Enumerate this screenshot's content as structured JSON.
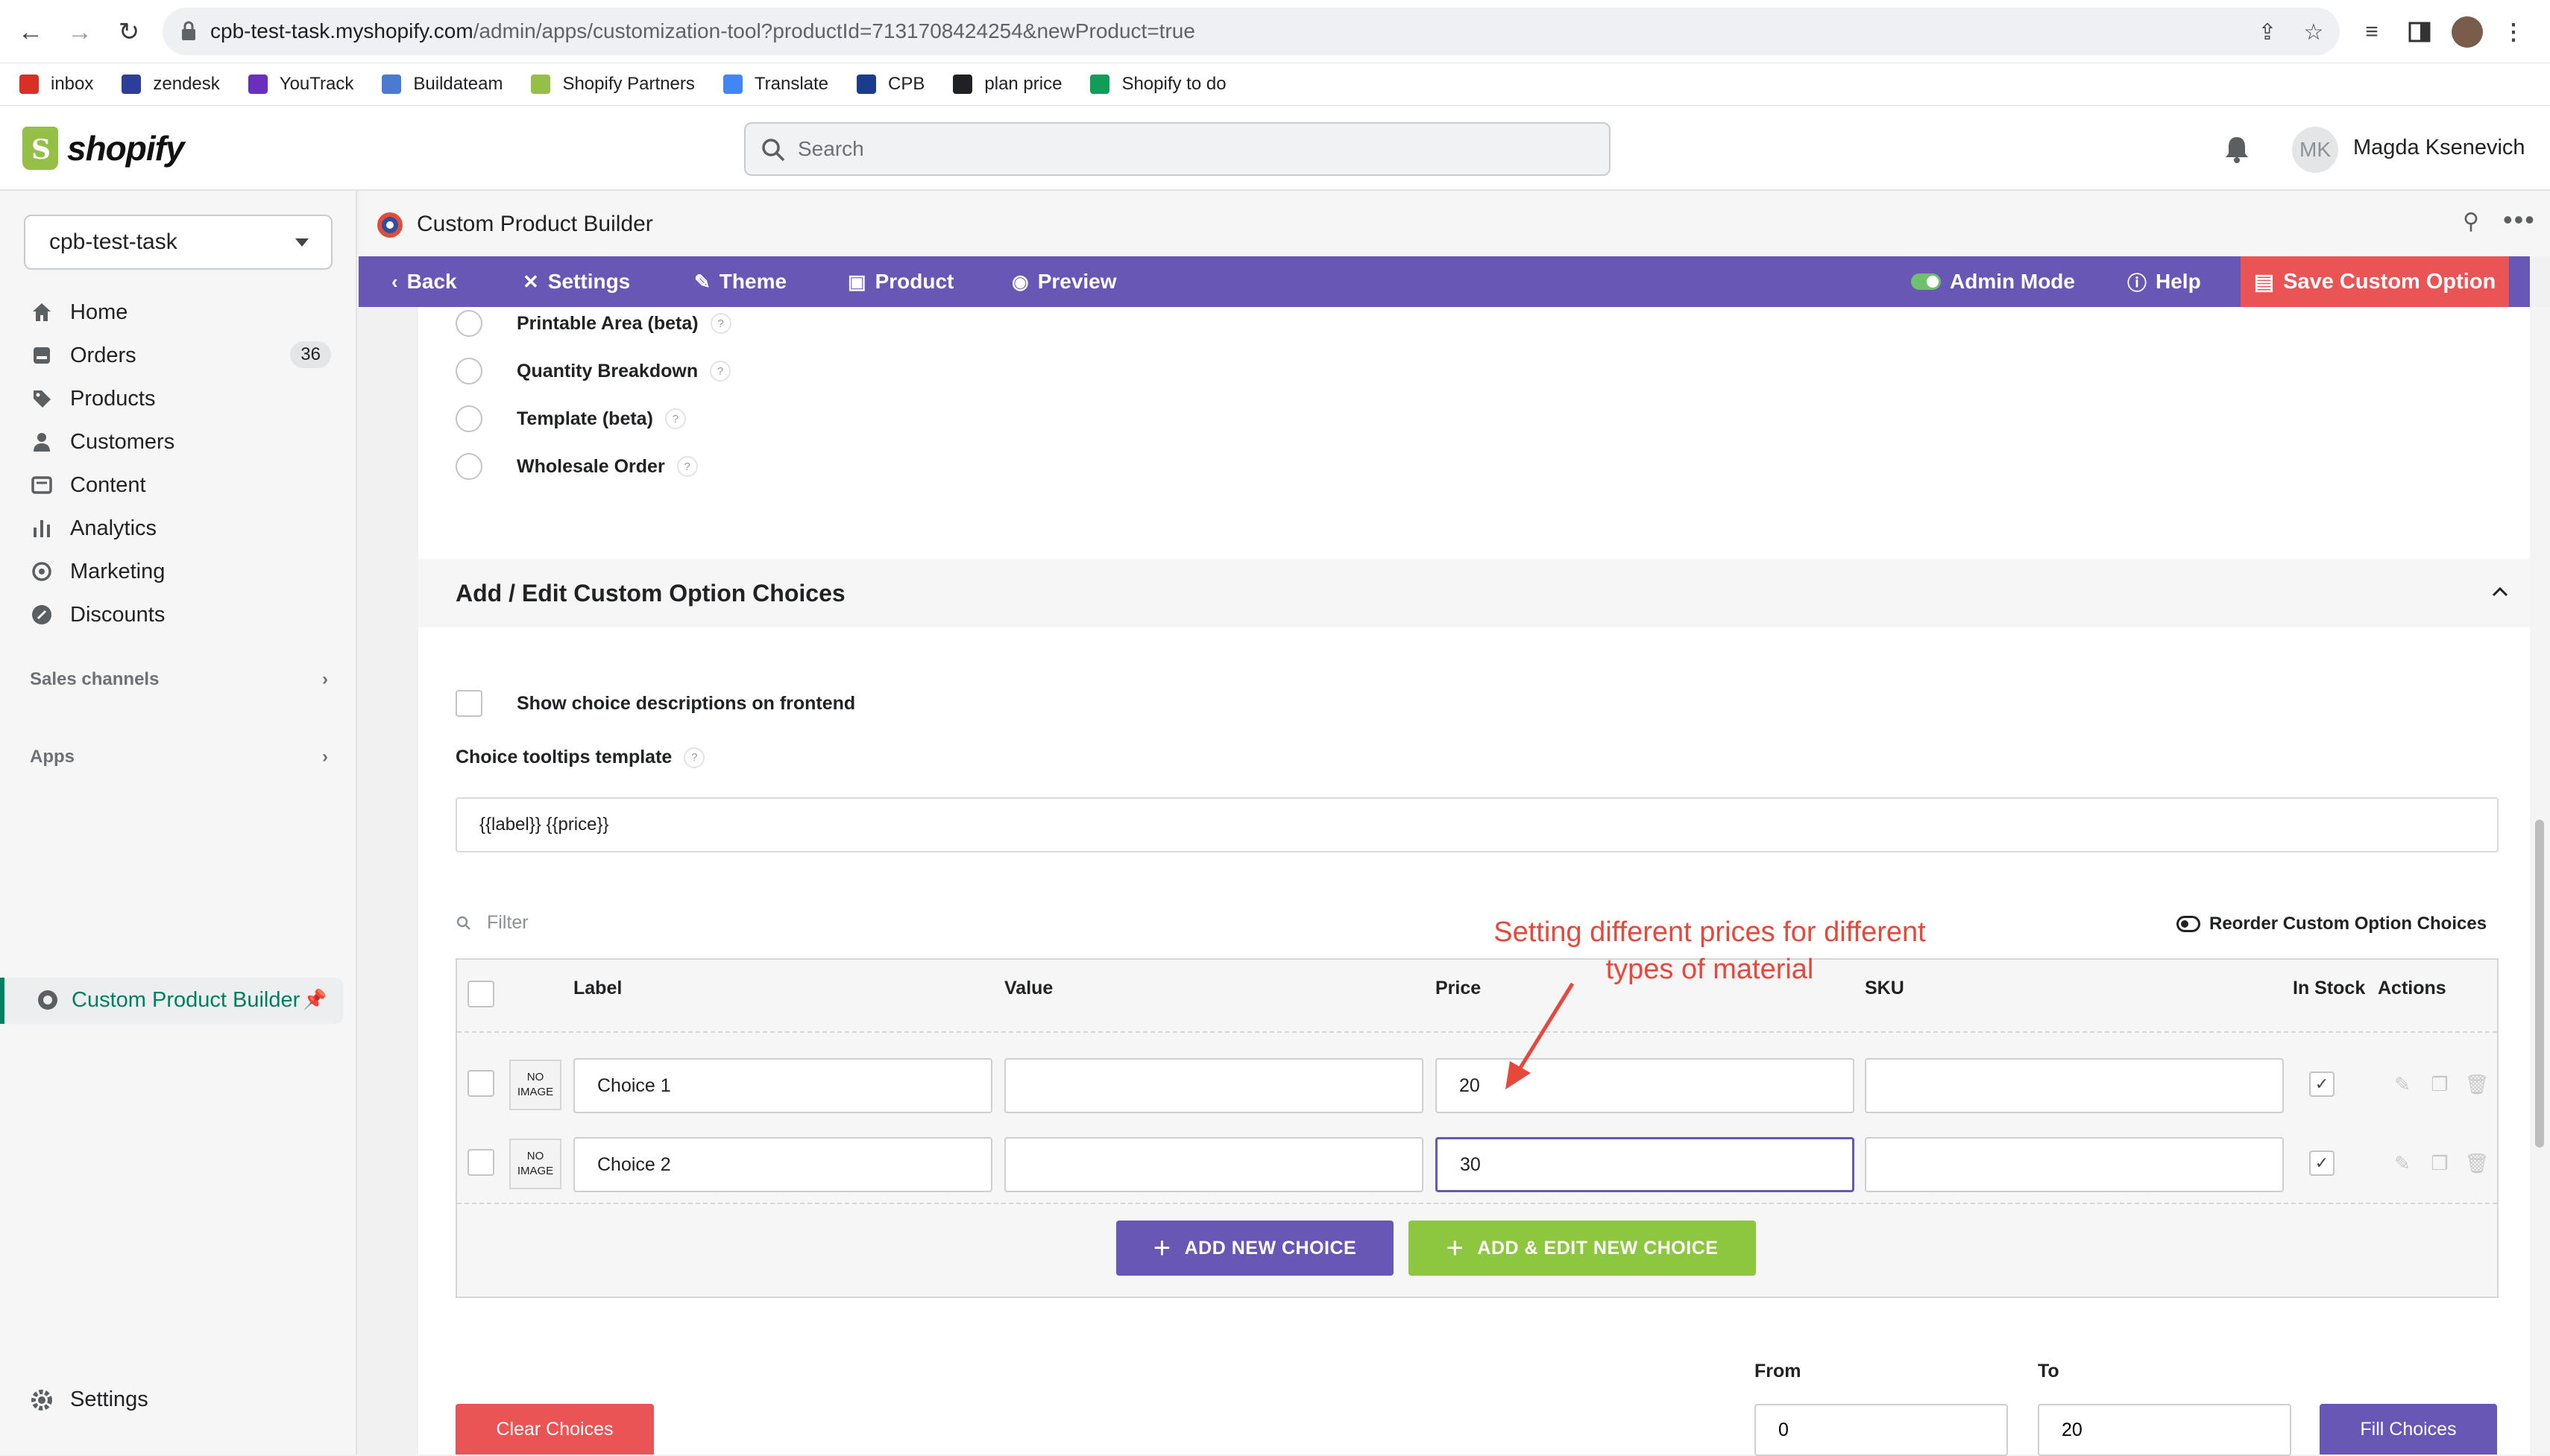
{
  "browser": {
    "url_host": "cpb-test-task.myshopify.com",
    "url_path": "/admin/apps/customization-tool?productId=7131708424254&newProduct=true",
    "bookmarks": [
      {
        "label": "inbox",
        "color": "#d93025"
      },
      {
        "label": "zendesk",
        "color": "#2c3e9a"
      },
      {
        "label": "YouTrack",
        "color": "#6b2fbf"
      },
      {
        "label": "Buildateam",
        "color": "#4a7bd0"
      },
      {
        "label": "Shopify Partners",
        "color": "#95bf47"
      },
      {
        "label": "Translate",
        "color": "#4285f4"
      },
      {
        "label": "CPB",
        "color": "#1a3c8c"
      },
      {
        "label": "plan price",
        "color": "#202124"
      },
      {
        "label": "Shopify to do",
        "color": "#0f9d58"
      }
    ]
  },
  "topbar": {
    "logo_text": "shopify",
    "search_placeholder": "Search",
    "avatar_initials": "MK",
    "user_name": "Magda Ksenevich"
  },
  "sidebar": {
    "store": "cpb-test-task",
    "items": [
      {
        "label": "Home",
        "icon": "home-icon"
      },
      {
        "label": "Orders",
        "icon": "orders-icon",
        "badge": "36"
      },
      {
        "label": "Products",
        "icon": "tag-icon"
      },
      {
        "label": "Customers",
        "icon": "person-icon"
      },
      {
        "label": "Content",
        "icon": "content-icon"
      },
      {
        "label": "Analytics",
        "icon": "bar-chart-icon"
      },
      {
        "label": "Marketing",
        "icon": "target-icon"
      },
      {
        "label": "Discounts",
        "icon": "discount-icon"
      }
    ],
    "sales_channels": "Sales channels",
    "apps": "Apps",
    "active_app": "Custom Product Builder",
    "settings": "Settings"
  },
  "app": {
    "title": "Custom Product Builder",
    "menu": {
      "back": "Back",
      "settings": "Settings",
      "theme": "Theme",
      "product": "Product",
      "preview": "Preview",
      "admin_mode": "Admin Mode",
      "help": "Help",
      "save": "Save Custom Option"
    }
  },
  "option_types": [
    {
      "label": "Printable Area (beta)"
    },
    {
      "label": "Quantity Breakdown"
    },
    {
      "label": "Template (beta)"
    },
    {
      "label": "Wholesale Order"
    }
  ],
  "choices_section": {
    "title": "Add / Edit Custom Option Choices",
    "show_descriptions": "Show choice descriptions on frontend",
    "tooltip_label": "Choice tooltips template",
    "tooltip_value": "{{label}} {{price}}",
    "filter_placeholder": "Filter",
    "reorder_label": "Reorder Custom Option Choices",
    "columns": [
      "Label",
      "Value",
      "Price",
      "SKU",
      "In Stock",
      "Actions"
    ],
    "no_image": "NO IMAGE",
    "rows": [
      {
        "label": "Choice 1",
        "value": "",
        "price": "20",
        "sku": "",
        "in_stock": true
      },
      {
        "label": "Choice 2",
        "value": "",
        "price": "30",
        "sku": "",
        "in_stock": true
      }
    ],
    "add_new": "ADD NEW CHOICE",
    "add_edit_new": "ADD & EDIT NEW CHOICE",
    "annotation": "Setting different prices for different types of material",
    "from_label": "From",
    "to_label": "To",
    "from_value": "0",
    "to_value": "20",
    "clear_btn": "Clear Choices",
    "fill_btn": "Fill Choices"
  },
  "colors": {
    "purple": "#6957b5",
    "red": "#ea5455",
    "green": "#8dc63f",
    "shopify_green": "#008060"
  }
}
